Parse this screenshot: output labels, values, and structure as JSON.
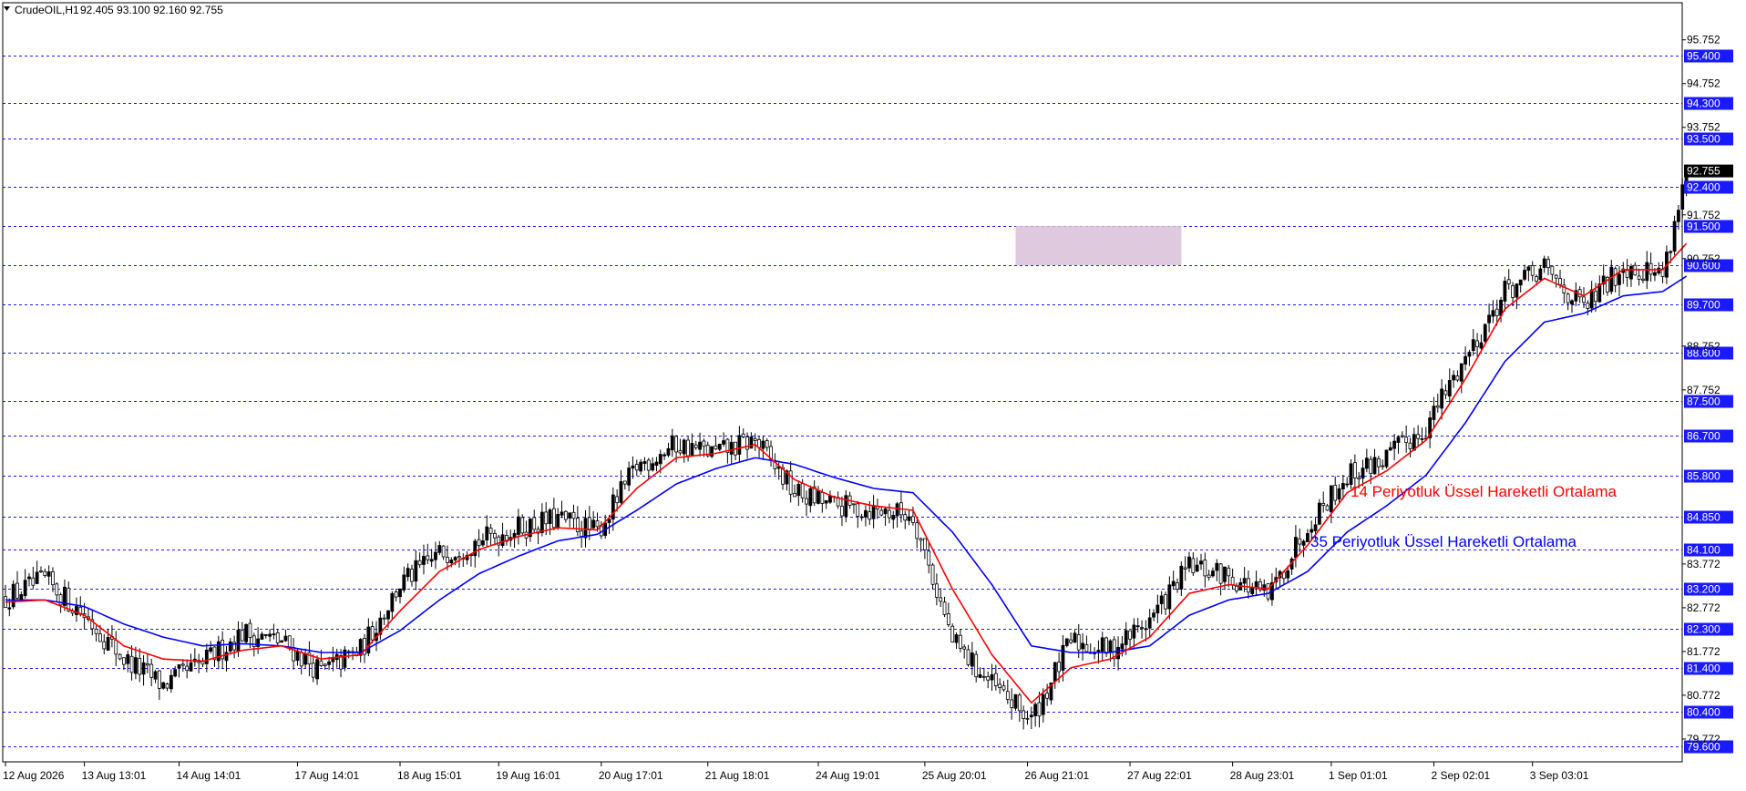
{
  "header": {
    "symbol_timeframe": "CrudeOIL,H1",
    "ohlc": "92.405 93.100 92.160 92.755"
  },
  "colors": {
    "background": "#ffffff",
    "grid_line": "#1a1aff",
    "candle": "#000000",
    "ema14": "#ff0000",
    "ema35": "#0000ff",
    "zone_fill": "#d8bfd8",
    "level_label_bg": "#1a1aff",
    "price_label_bg": "#000000"
  },
  "chart_data": {
    "type": "candlestick",
    "symbol": "CrudeOIL",
    "timeframe": "H1",
    "last_price": 92.755,
    "ylim": [
      79.25,
      96.6
    ],
    "y_tick_labels": [
      "95.752",
      "94.752",
      "93.752",
      "91.752",
      "90.752",
      "88.752",
      "87.752",
      "83.772",
      "82.772",
      "81.772",
      "80.772",
      "79.772"
    ],
    "horizontal_levels": [
      95.4,
      94.3,
      93.5,
      92.4,
      91.5,
      90.6,
      89.7,
      88.6,
      87.5,
      86.7,
      85.8,
      84.85,
      84.1,
      83.2,
      82.3,
      81.4,
      80.4,
      79.6
    ],
    "horizontal_level_labels": [
      "95.400",
      "94.300",
      "93.500",
      "92.400",
      "91.500",
      "90.600",
      "89.700",
      "88.600",
      "87.500",
      "86.700",
      "85.800",
      "84.850",
      "84.100",
      "83.200",
      "82.300",
      "81.400",
      "80.400",
      "79.600"
    ],
    "current_price_label": "92.755",
    "x_tick_labels": [
      "12 Aug 2026",
      "13 Aug 13:01",
      "14 Aug 14:01",
      "17 Aug 14:01",
      "18 Aug 15:01",
      "19 Aug 16:01",
      "20 Aug 17:01",
      "21 Aug 18:01",
      "24 Aug 19:01",
      "25 Aug 20:01",
      "26 Aug 21:01",
      "27 Aug 22:01",
      "28 Aug 23:01",
      "1 Sep 01:01",
      "2 Sep 02:01",
      "3 Sep 03:01"
    ],
    "zone": {
      "low": 90.6,
      "high": 91.5,
      "from_index": 256,
      "to_index": 298
    },
    "annotations": [
      {
        "text": "14 Periyotluk Üssel Hareketli Ortalama",
        "color": "#ff0000"
      },
      {
        "text": "35 Periyotluk Üssel Hareketli Ortalama",
        "color": "#0000ff"
      }
    ],
    "close_path": [
      [
        0,
        83.0
      ],
      [
        10,
        83.4
      ],
      [
        20,
        82.6
      ],
      [
        30,
        81.6
      ],
      [
        40,
        81.0
      ],
      [
        50,
        81.5
      ],
      [
        60,
        82.2
      ],
      [
        70,
        82.0
      ],
      [
        80,
        81.3
      ],
      [
        90,
        81.8
      ],
      [
        100,
        83.3
      ],
      [
        110,
        84.0
      ],
      [
        120,
        84.3
      ],
      [
        130,
        84.6
      ],
      [
        140,
        84.8
      ],
      [
        150,
        84.5
      ],
      [
        160,
        86.0
      ],
      [
        170,
        86.5
      ],
      [
        180,
        86.3
      ],
      [
        190,
        86.6
      ],
      [
        200,
        85.4
      ],
      [
        210,
        85.1
      ],
      [
        220,
        85.0
      ],
      [
        230,
        84.9
      ],
      [
        240,
        82.0
      ],
      [
        250,
        81.0
      ],
      [
        260,
        80.2
      ],
      [
        270,
        82.0
      ],
      [
        280,
        81.8
      ],
      [
        290,
        82.5
      ],
      [
        300,
        83.7
      ],
      [
        310,
        83.5
      ],
      [
        320,
        83.0
      ],
      [
        330,
        84.7
      ],
      [
        340,
        85.8
      ],
      [
        350,
        86.2
      ],
      [
        360,
        86.9
      ],
      [
        370,
        88.5
      ],
      [
        380,
        90.0
      ],
      [
        390,
        90.5
      ],
      [
        400,
        89.6
      ],
      [
        410,
        90.6
      ],
      [
        420,
        90.4
      ],
      [
        426,
        92.755
      ]
    ],
    "ema14_path": [
      [
        0,
        82.9
      ],
      [
        10,
        82.95
      ],
      [
        20,
        82.6
      ],
      [
        30,
        81.9
      ],
      [
        40,
        81.6
      ],
      [
        50,
        81.55
      ],
      [
        60,
        81.8
      ],
      [
        70,
        81.9
      ],
      [
        80,
        81.6
      ],
      [
        90,
        81.7
      ],
      [
        100,
        82.7
      ],
      [
        110,
        83.6
      ],
      [
        120,
        84.1
      ],
      [
        130,
        84.4
      ],
      [
        140,
        84.6
      ],
      [
        150,
        84.55
      ],
      [
        160,
        85.5
      ],
      [
        170,
        86.2
      ],
      [
        180,
        86.3
      ],
      [
        190,
        86.5
      ],
      [
        200,
        85.7
      ],
      [
        210,
        85.3
      ],
      [
        220,
        85.1
      ],
      [
        230,
        85.0
      ],
      [
        240,
        83.2
      ],
      [
        250,
        81.7
      ],
      [
        260,
        80.6
      ],
      [
        270,
        81.4
      ],
      [
        280,
        81.6
      ],
      [
        290,
        82.1
      ],
      [
        300,
        83.1
      ],
      [
        310,
        83.3
      ],
      [
        320,
        83.2
      ],
      [
        330,
        84.2
      ],
      [
        340,
        85.4
      ],
      [
        350,
        85.9
      ],
      [
        360,
        86.6
      ],
      [
        370,
        88.0
      ],
      [
        380,
        89.6
      ],
      [
        390,
        90.3
      ],
      [
        400,
        89.9
      ],
      [
        410,
        90.5
      ],
      [
        420,
        90.5
      ],
      [
        426,
        91.1
      ]
    ],
    "ema35_path": [
      [
        0,
        82.95
      ],
      [
        10,
        82.95
      ],
      [
        20,
        82.8
      ],
      [
        30,
        82.4
      ],
      [
        40,
        82.1
      ],
      [
        50,
        81.9
      ],
      [
        60,
        81.95
      ],
      [
        70,
        81.9
      ],
      [
        80,
        81.75
      ],
      [
        90,
        81.75
      ],
      [
        100,
        82.25
      ],
      [
        110,
        82.95
      ],
      [
        120,
        83.55
      ],
      [
        130,
        83.95
      ],
      [
        140,
        84.3
      ],
      [
        150,
        84.45
      ],
      [
        160,
        85.0
      ],
      [
        170,
        85.6
      ],
      [
        180,
        85.95
      ],
      [
        190,
        86.2
      ],
      [
        200,
        86.05
      ],
      [
        210,
        85.75
      ],
      [
        220,
        85.5
      ],
      [
        230,
        85.4
      ],
      [
        240,
        84.5
      ],
      [
        250,
        83.3
      ],
      [
        260,
        81.9
      ],
      [
        270,
        81.75
      ],
      [
        280,
        81.75
      ],
      [
        290,
        81.9
      ],
      [
        300,
        82.6
      ],
      [
        310,
        82.95
      ],
      [
        320,
        83.1
      ],
      [
        330,
        83.6
      ],
      [
        340,
        84.5
      ],
      [
        350,
        85.1
      ],
      [
        360,
        85.8
      ],
      [
        370,
        87.0
      ],
      [
        380,
        88.4
      ],
      [
        390,
        89.3
      ],
      [
        400,
        89.5
      ],
      [
        410,
        89.9
      ],
      [
        420,
        90.0
      ],
      [
        426,
        90.35
      ]
    ],
    "candle_count": 427,
    "x_tick_indices": [
      0,
      20,
      44,
      74,
      100,
      125,
      151,
      178,
      206,
      233,
      259,
      285,
      311,
      336,
      362,
      387
    ],
    "chart_area": "left",
    "price_axis": "right"
  }
}
